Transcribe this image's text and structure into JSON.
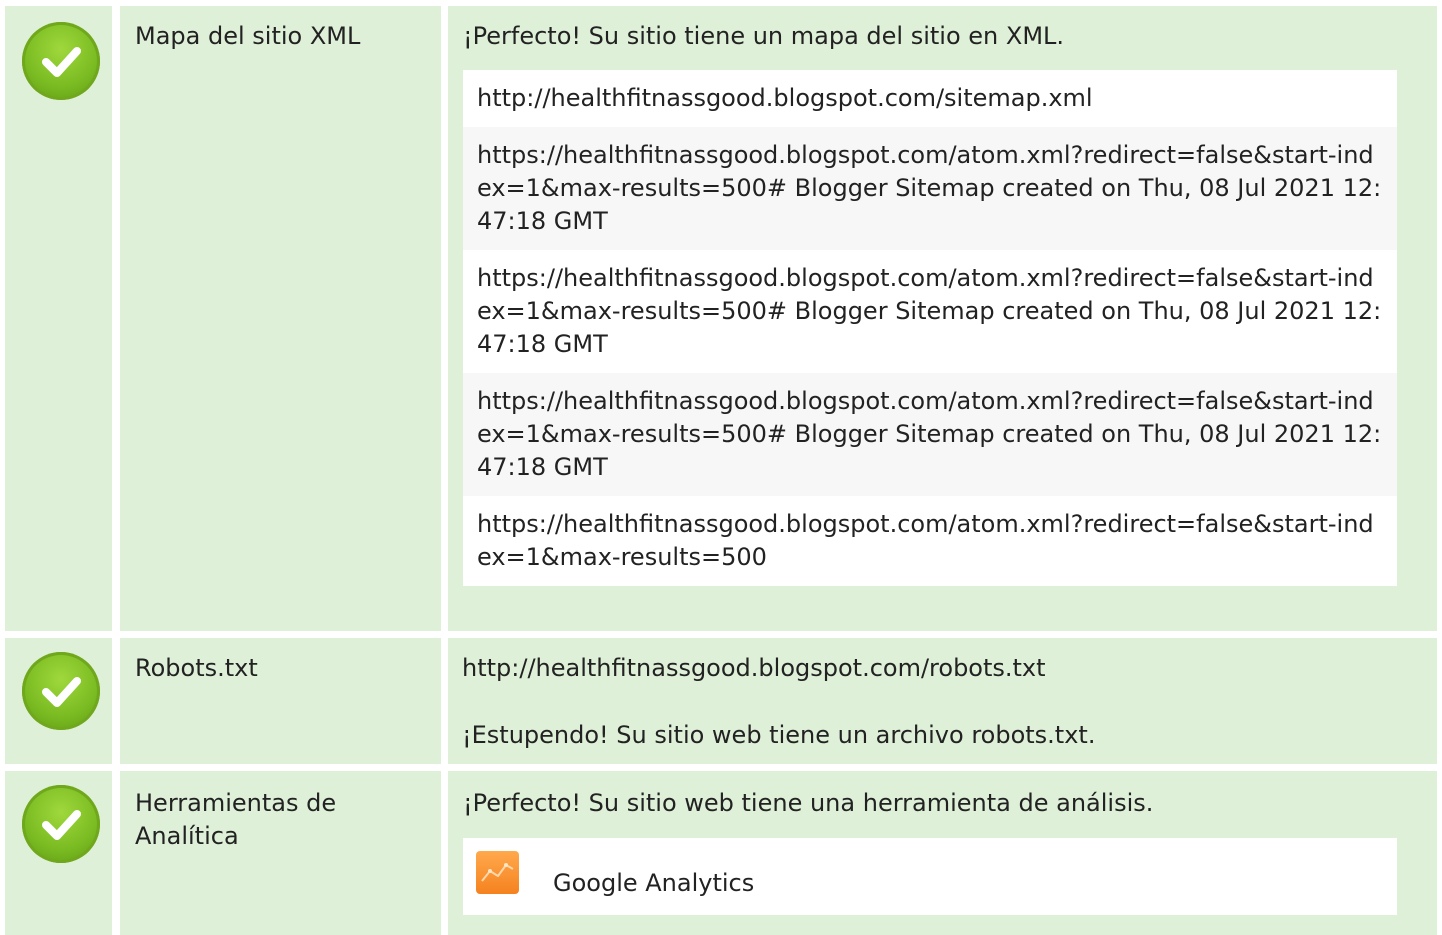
{
  "rows": [
    {
      "status": "pass",
      "icon": "check-icon",
      "label": "Mapa del sitio XML",
      "message": "¡Perfecto! Su sitio tiene un mapa del sitio en XML.",
      "sitemaps": [
        "http://healthfitnassgood.blogspot.com/sitemap.xml",
        "https://healthfitnassgood.blogspot.com/atom.xml?redirect=false&start-index=1&max-results=500# Blogger Sitemap created on Thu, 08 Jul 2021 12:47:18 GMT",
        "https://healthfitnassgood.blogspot.com/atom.xml?redirect=false&start-index=1&max-results=500# Blogger Sitemap created on Thu, 08 Jul 2021 12:47:18 GMT",
        "https://healthfitnassgood.blogspot.com/atom.xml?redirect=false&start-index=1&max-results=500# Blogger Sitemap created on Thu, 08 Jul 2021 12:47:18 GMT",
        "https://healthfitnassgood.blogspot.com/atom.xml?redirect=false&start-index=1&max-results=500"
      ]
    },
    {
      "status": "pass",
      "icon": "check-icon",
      "label": "Robots.txt",
      "url": "http://healthfitnassgood.blogspot.com/robots.txt",
      "message": "¡Estupendo! Su sitio web tiene un archivo robots.txt."
    },
    {
      "status": "pass",
      "icon": "check-icon",
      "label": "Herramientas de Analítica",
      "message": "¡Perfecto! Su sitio web tiene una herramienta de análisis.",
      "tool": {
        "icon": "google-analytics-icon",
        "name": "Google Analytics"
      }
    }
  ],
  "colors": {
    "row_bg": "#dff0d8",
    "check_green": "#7cbd23",
    "ga_orange": "#f5821f"
  }
}
